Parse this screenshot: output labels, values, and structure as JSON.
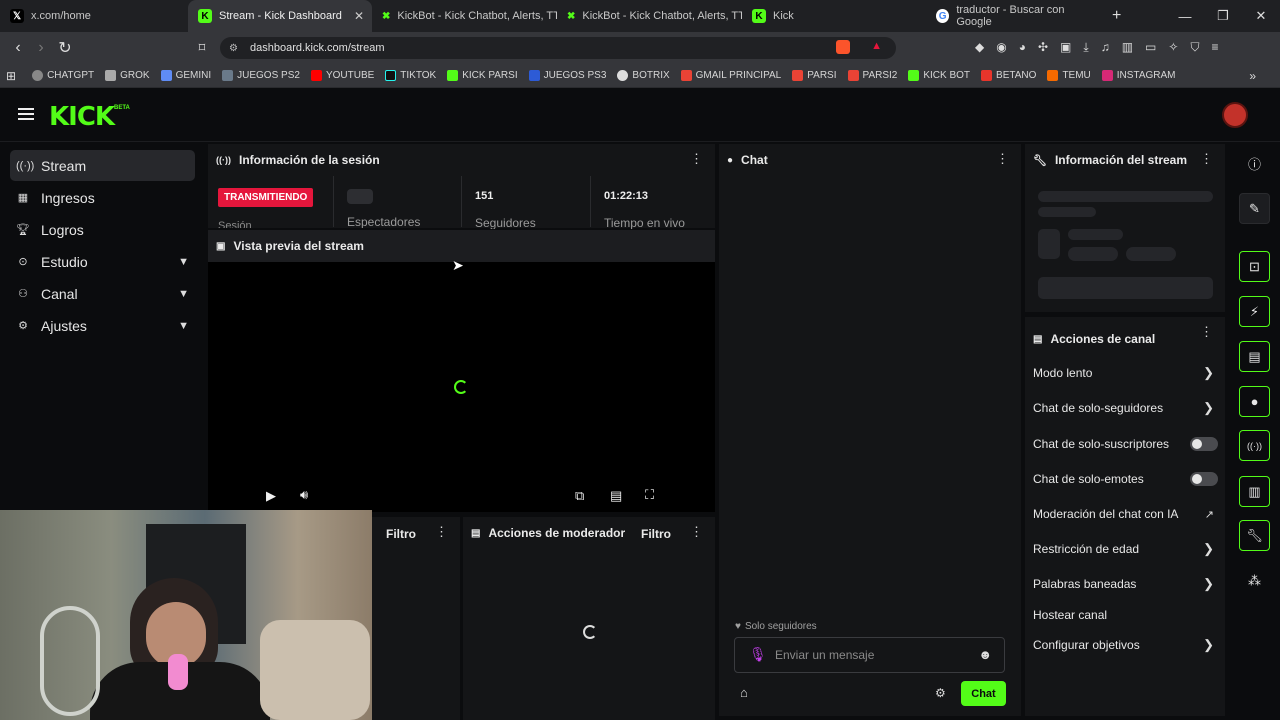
{
  "browser": {
    "tabs": [
      {
        "title": "x.com/home",
        "icon": "x-icon"
      },
      {
        "title": "Stream - Kick Dashboard",
        "icon": "kick-icon"
      },
      {
        "title": "KickBot - Kick Chatbot, Alerts, TTS",
        "icon": "kickbot-icon"
      },
      {
        "title": "KickBot - Kick Chatbot, Alerts, TTS",
        "icon": "kickbot-icon"
      },
      {
        "title": "Kick",
        "icon": "kick-icon"
      },
      {
        "title": "traductor - Buscar con Google",
        "icon": "google-icon"
      }
    ],
    "url": "dashboard.kick.com/stream",
    "bookmarks": [
      "CHATGPT",
      "GROK",
      "GEMINI",
      "JUEGOS PS2",
      "YOUTUBE",
      "TIKTOK",
      "KICK PARSI",
      "JUEGOS PS3",
      "BOTRIX",
      "GMAIL PRINCIPAL",
      "PARSI",
      "PARSI2",
      "KICK BOT",
      "BETANO",
      "TEMU",
      "INSTAGRAM"
    ]
  },
  "header": {
    "logo": "KICK",
    "beta": "BETA"
  },
  "sidebar": {
    "items": [
      {
        "label": "Stream",
        "icon": "broadcast-icon"
      },
      {
        "label": "Ingresos",
        "icon": "revenue-icon"
      },
      {
        "label": "Logros",
        "icon": "trophy-icon"
      },
      {
        "label": "Estudio",
        "icon": "studio-icon"
      },
      {
        "label": "Canal",
        "icon": "channel-icon"
      },
      {
        "label": "Ajustes",
        "icon": "gear-icon"
      }
    ]
  },
  "session": {
    "title": "Información de la sesión",
    "status_badge": "TRANSMITIENDO",
    "session_label": "Sesión",
    "viewers_label": "Espectadores",
    "followers_value": "151",
    "followers_label": "Seguidores",
    "live_time_value": "01:22:13",
    "live_time_label": "Tiempo en vivo"
  },
  "preview": {
    "title": "Vista previa del stream"
  },
  "lower_panels": {
    "filter_label": "Filtro",
    "mod_actions_title": "Acciones de moderador",
    "mod_filter_label": "Filtro"
  },
  "chat": {
    "title": "Chat",
    "followers_only": "Solo seguidores",
    "placeholder": "Enviar un mensaje",
    "send_button": "Chat"
  },
  "stream_info": {
    "title": "Información del stream"
  },
  "channel_actions": {
    "title": "Acciones de canal",
    "items": [
      {
        "label": "Modo lento",
        "control": "arrow"
      },
      {
        "label": "Chat de solo-seguidores",
        "control": "arrow"
      },
      {
        "label": "Chat de solo-suscriptores",
        "control": "toggle"
      },
      {
        "label": "Chat de solo-emotes",
        "control": "toggle"
      },
      {
        "label": "Moderación del chat con IA",
        "control": "external"
      },
      {
        "label": "Restricción de edad",
        "control": "arrow"
      },
      {
        "label": "Palabras baneadas",
        "control": "arrow"
      },
      {
        "label": "Hostear canal",
        "control": "none"
      },
      {
        "label": "Configurar objetivos",
        "control": "arrow"
      }
    ]
  },
  "colors": {
    "accent": "#53fc18",
    "live_badge": "#e5163c",
    "panel": "#141517",
    "background": "#0b0c0e"
  }
}
